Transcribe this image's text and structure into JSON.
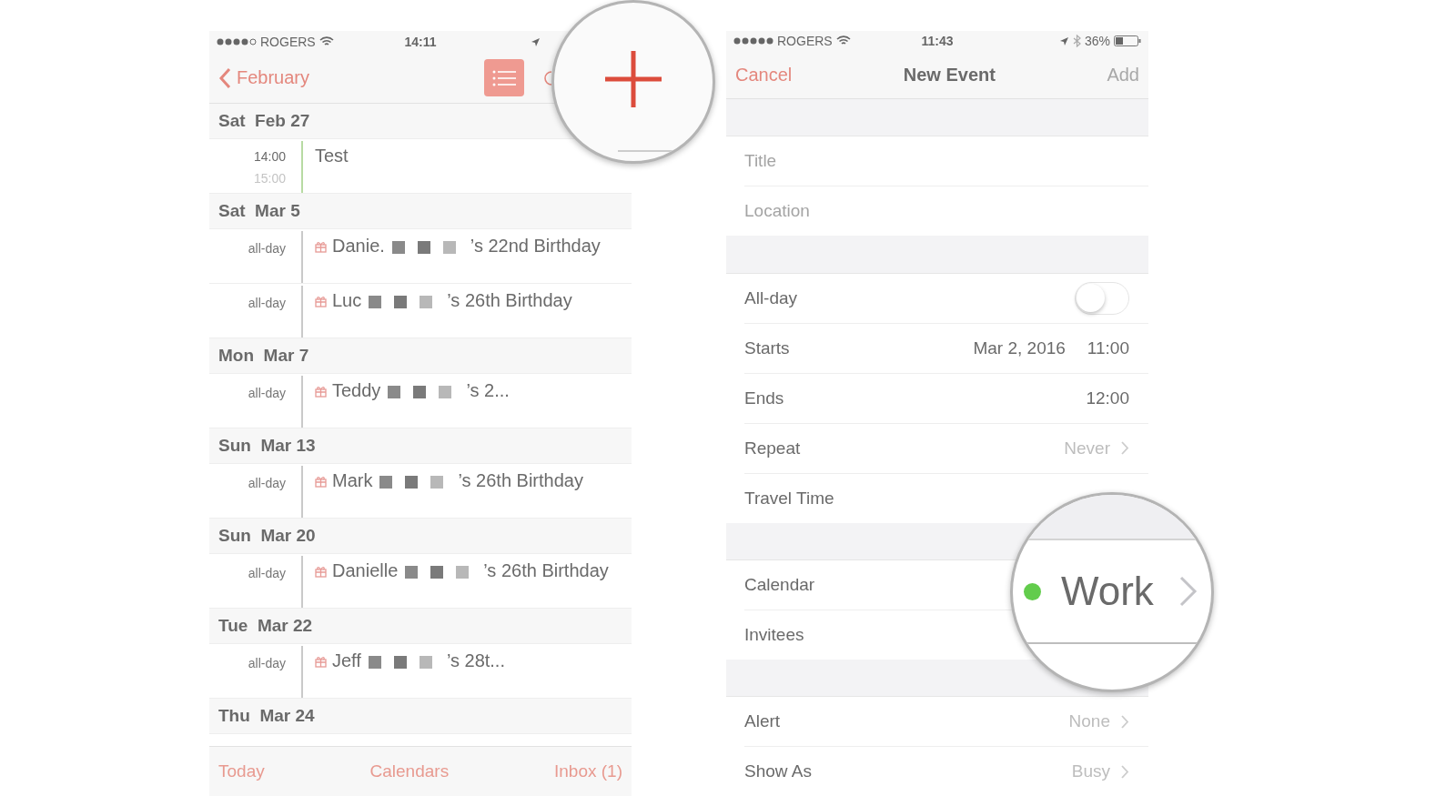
{
  "left_screen": {
    "status_bar": {
      "carrier": "ROGERS",
      "time": "14:11"
    },
    "nav": {
      "back": "February"
    },
    "days": [
      {
        "header": "Sat  Feb 27",
        "events": [
          {
            "kind": "timed",
            "start": "14:00",
            "end": "15:00",
            "title": "Test",
            "color": "#b7dba3"
          }
        ]
      },
      {
        "header": "Sat  Mar 5",
        "events": [
          {
            "kind": "birthday",
            "time": "all-day",
            "name": "Danie.",
            "suffix": "’s 22nd Birthday",
            "color": "#c9c9c9"
          },
          {
            "kind": "birthday",
            "time": "all-day",
            "name": "Luc",
            "suffix": "’s 26th Birthday",
            "color": "#c9c9c9"
          }
        ]
      },
      {
        "header": "Mon  Mar 7",
        "events": [
          {
            "kind": "birthday",
            "time": "all-day",
            "name": "Teddy",
            "suffix": "’s 2...",
            "color": "#c9c9c9"
          }
        ]
      },
      {
        "header": "Sun  Mar 13",
        "events": [
          {
            "kind": "birthday",
            "time": "all-day",
            "name": "Mark",
            "suffix": "’s 26th Birthday",
            "color": "#c9c9c9"
          }
        ]
      },
      {
        "header": "Sun  Mar 20",
        "events": [
          {
            "kind": "birthday",
            "time": "all-day",
            "name": "Danielle",
            "suffix": "’s 26th Birthday",
            "color": "#c9c9c9"
          }
        ]
      },
      {
        "header": "Tue  Mar 22",
        "events": [
          {
            "kind": "birthday",
            "time": "all-day",
            "name": "Jeff",
            "suffix": "’s 28t...",
            "color": "#c9c9c9"
          }
        ]
      },
      {
        "header": "Thu  Mar 24"
      }
    ],
    "tab_bar": [
      "Today",
      "Calendars",
      "Inbox (1)"
    ]
  },
  "right_screen": {
    "status_bar": {
      "carrier": "ROGERS",
      "time": "11:43",
      "battery": "36%"
    },
    "nav": {
      "cancel": "Cancel",
      "title": "New Event",
      "add": "Add"
    },
    "fields": [
      {
        "placeholder": "Title"
      },
      {
        "placeholder": "Location"
      }
    ],
    "groups": [
      [
        {
          "kind": "toggle",
          "label": "All-day",
          "on": false
        },
        {
          "kind": "values",
          "label": "Starts",
          "values": [
            "Mar 2, 2016",
            "11:00"
          ]
        },
        {
          "kind": "values",
          "label": "Ends",
          "values": [
            "12:00"
          ]
        },
        {
          "kind": "detail",
          "label": "Repeat",
          "value": "Never"
        },
        {
          "kind": "plain",
          "label": "Travel Time"
        }
      ],
      [
        {
          "kind": "plain",
          "label": "Calendar"
        },
        {
          "kind": "plain",
          "label": "Invitees"
        }
      ],
      [
        {
          "kind": "detail",
          "label": "Alert",
          "value": "None"
        },
        {
          "kind": "detail",
          "label": "Show As",
          "value": "Busy"
        }
      ]
    ]
  },
  "calendar_magnifier": {
    "value": "Work",
    "color": "#62cc4c"
  }
}
